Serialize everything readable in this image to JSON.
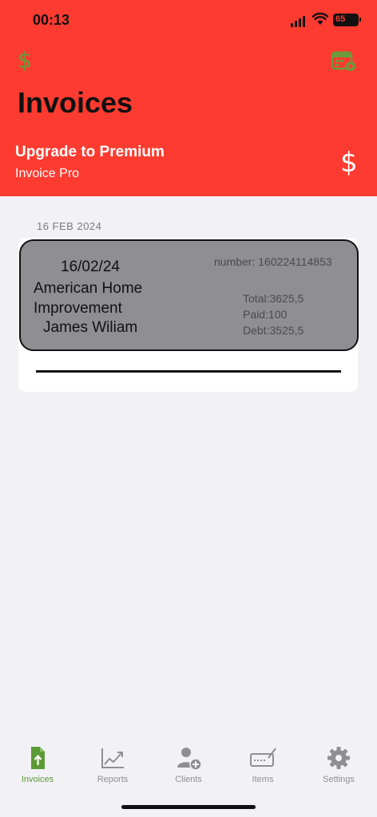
{
  "status_bar": {
    "time": "00:13",
    "battery": "65"
  },
  "header": {
    "left_icon": "dollar-icon",
    "right_icon": "calendar-add-icon",
    "title": "Invoices"
  },
  "premium": {
    "title": "Upgrade to Premium",
    "subtitle": "Invoice Pro",
    "icon": "dollar-icon"
  },
  "section": {
    "date": "16 FEB 2024"
  },
  "invoice": {
    "date": "16/02/24",
    "client_line1": "American Home",
    "client_line2": "Improvement",
    "person": "James Wiliam",
    "number": "number: 160224114853",
    "total": "Total:3625,5",
    "paid": "Paid:100",
    "debt": "Debt:3525,5"
  },
  "tabs": [
    {
      "label": "Invoices",
      "icon": "invoice-icon",
      "active": true
    },
    {
      "label": "Reports",
      "icon": "chart-icon",
      "active": false
    },
    {
      "label": "Clients",
      "icon": "add-person-icon",
      "active": false
    },
    {
      "label": "Items",
      "icon": "items-icon",
      "active": false
    },
    {
      "label": "Settings",
      "icon": "gear-icon",
      "active": false
    }
  ],
  "colors": {
    "header": "#fe3b30",
    "accent_green": "#5c9a36",
    "card_gray": "#8e8e93",
    "background": "#f2f1f6"
  }
}
